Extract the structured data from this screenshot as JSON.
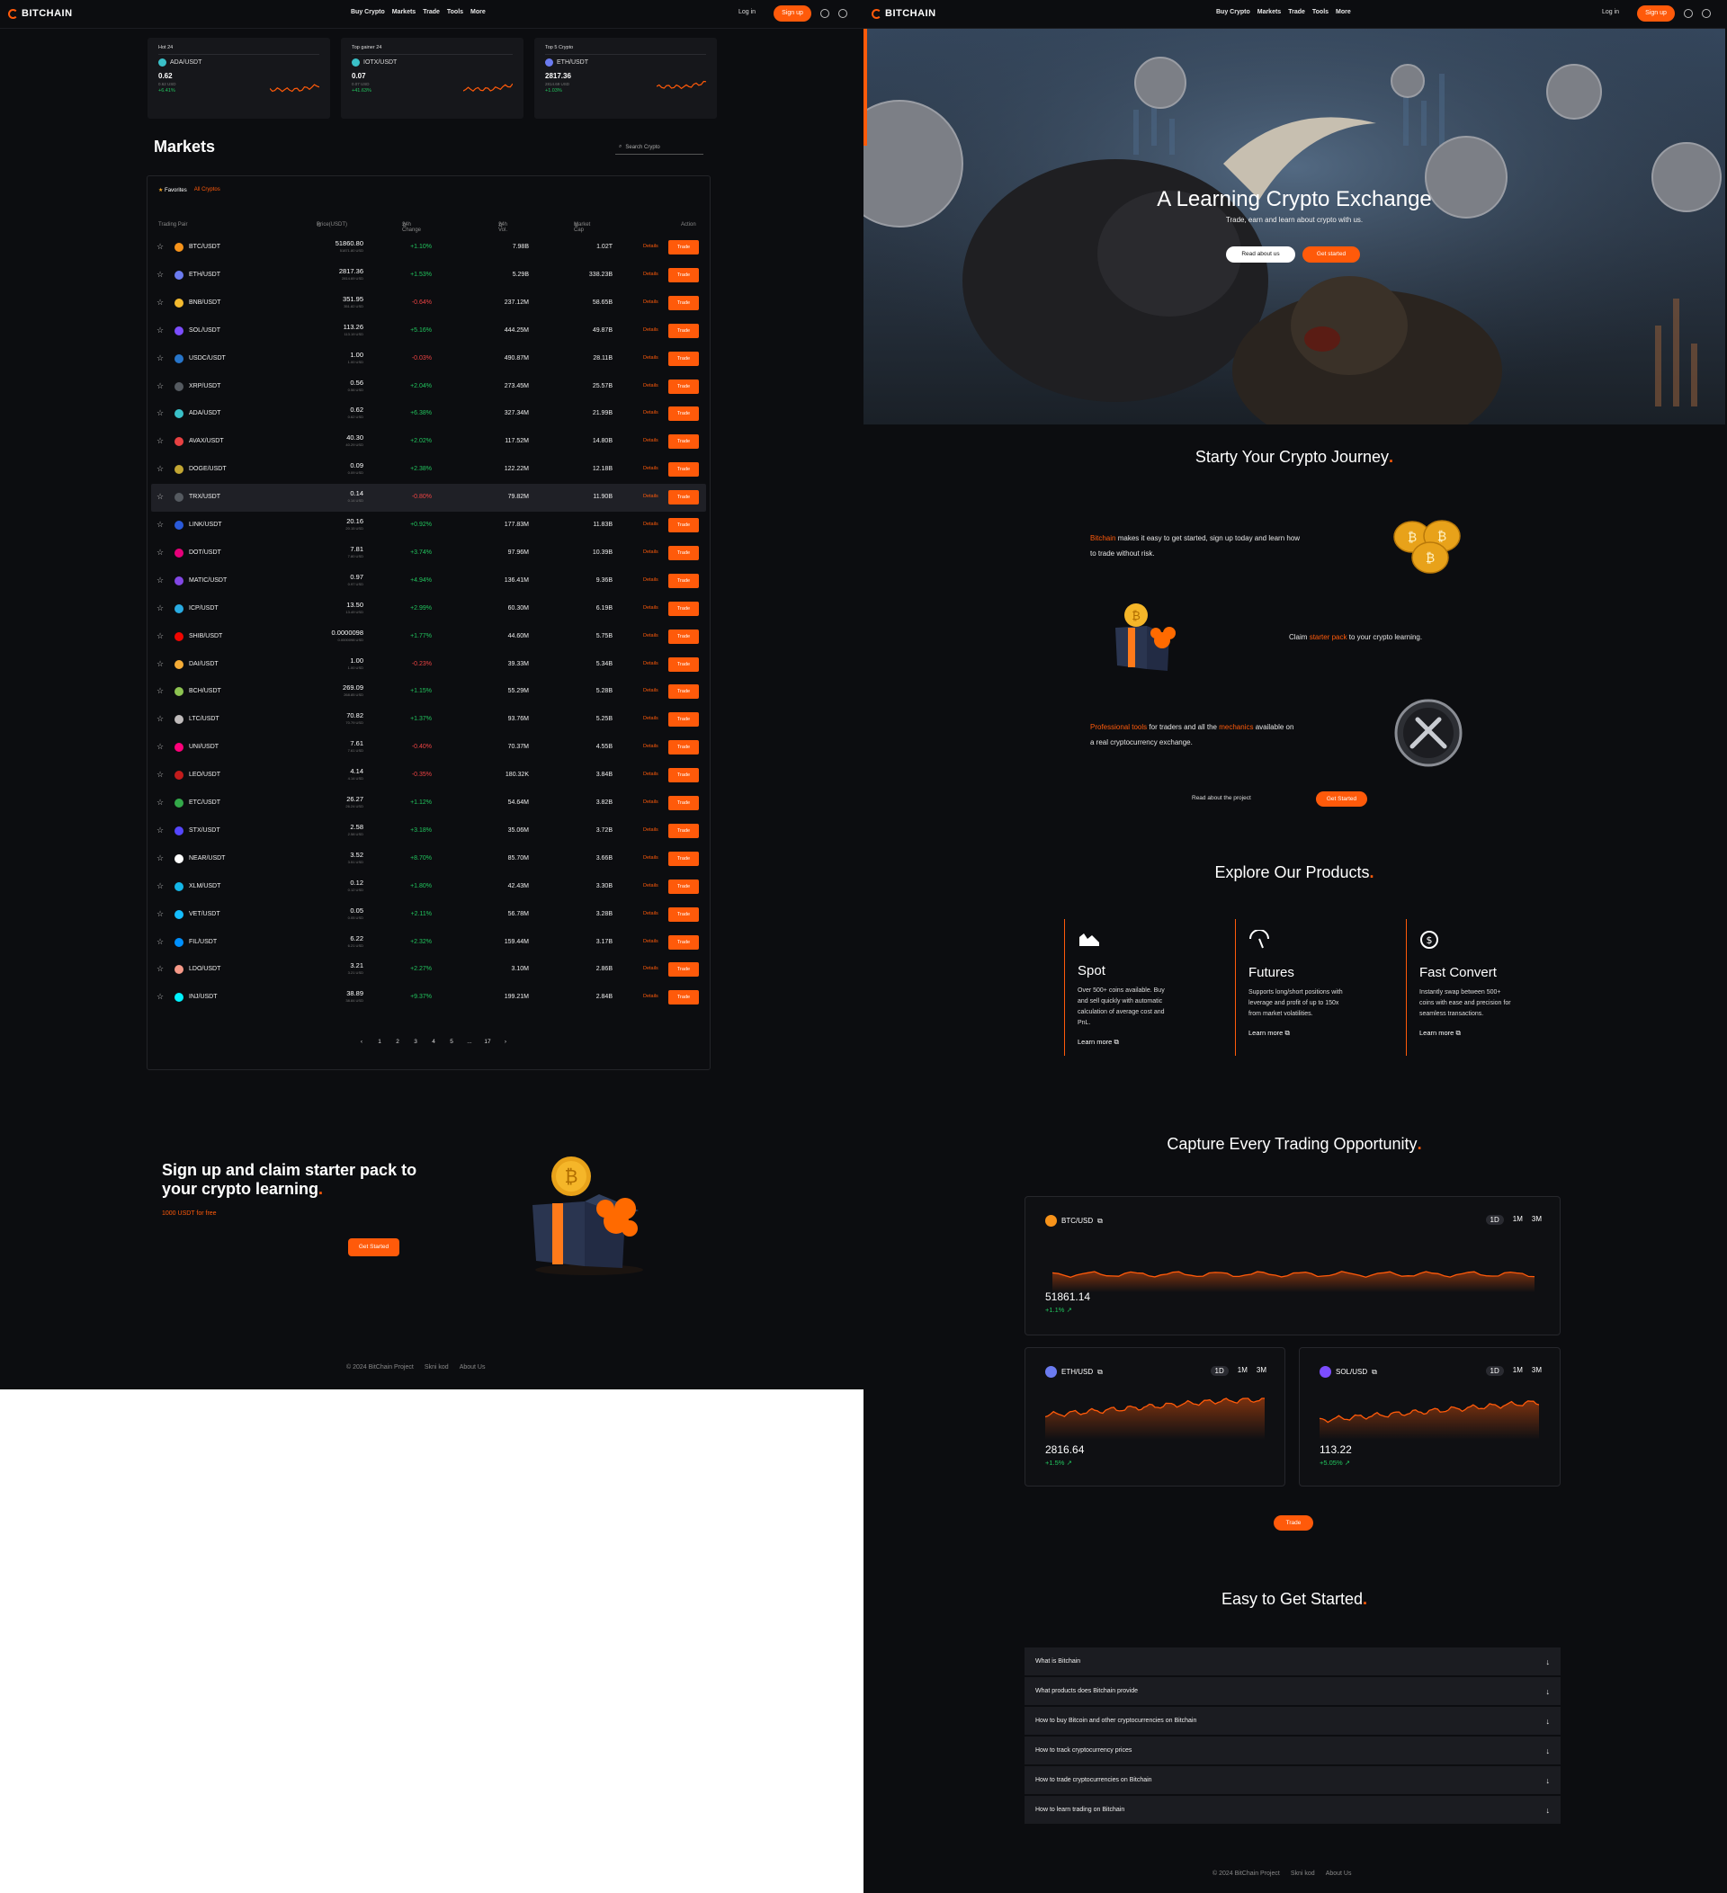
{
  "nav": {
    "brand": "BITCHAIN",
    "menu": [
      "Buy Crypto",
      "Markets",
      "Trade",
      "Tools",
      "More"
    ],
    "login": "Log in",
    "signup": "Sign up"
  },
  "cards": [
    {
      "label": "Hot 24",
      "pair": "ADA/USDT",
      "value": "0.62",
      "sub": "0.62 USD",
      "change": "+6.41%",
      "color": "#3ac0c8"
    },
    {
      "label": "Top gainer 24",
      "pair": "IOTX/USDT",
      "value": "0.07",
      "sub": "0.07 USD",
      "change": "+41.63%",
      "color": "#3ac0c8"
    },
    {
      "label": "Top 5 Crypto",
      "pair": "ETH/USDT",
      "value": "2817.36",
      "sub": "2814.69 USD",
      "change": "+1.03%",
      "color": "#6b7bf0"
    }
  ],
  "markets": {
    "title": "Markets",
    "search_placeholder": "Search Crypto",
    "tab_favorites": "Favorites",
    "tab_all": "All Cryptos",
    "headers": {
      "pair": "Trading Pair",
      "price": "Price(USDT)",
      "change": "24h Change",
      "vol": "24h Vol.",
      "cap": "Market Cap",
      "action": "Action"
    },
    "details_label": "Details",
    "trade_label": "Trade",
    "rows": [
      {
        "pair": "BTC/USDT",
        "price": "51860.80",
        "sub": "51871.80 USD",
        "change": "+1.10%",
        "vol": "7.98B",
        "cap": "1.02T",
        "color": "#f7931a"
      },
      {
        "pair": "ETH/USDT",
        "price": "2817.36",
        "sub": "2814.69 USD",
        "change": "+1.53%",
        "vol": "5.29B",
        "cap": "338.23B",
        "color": "#6b7bf0"
      },
      {
        "pair": "BNB/USDT",
        "price": "351.95",
        "sub": "351.82 USD",
        "change": "-0.64%",
        "vol": "237.12M",
        "cap": "58.65B",
        "color": "#f3ba2f"
      },
      {
        "pair": "SOL/USDT",
        "price": "113.26",
        "sub": "113.19 USD",
        "change": "+5.16%",
        "vol": "444.25M",
        "cap": "49.87B",
        "color": "#7c4dff"
      },
      {
        "pair": "USDC/USDT",
        "price": "1.00",
        "sub": "1.00 USD",
        "change": "-0.03%",
        "vol": "490.87M",
        "cap": "28.11B",
        "color": "#2775ca"
      },
      {
        "pair": "XRP/USDT",
        "price": "0.56",
        "sub": "0.56 USD",
        "change": "+2.04%",
        "vol": "273.45M",
        "cap": "25.57B",
        "color": "#555a60"
      },
      {
        "pair": "ADA/USDT",
        "price": "0.62",
        "sub": "0.62 USD",
        "change": "+6.38%",
        "vol": "327.34M",
        "cap": "21.99B",
        "color": "#3ac0c8"
      },
      {
        "pair": "AVAX/USDT",
        "price": "40.30",
        "sub": "40.29 USD",
        "change": "+2.02%",
        "vol": "117.52M",
        "cap": "14.80B",
        "color": "#e84142"
      },
      {
        "pair": "DOGE/USDT",
        "price": "0.09",
        "sub": "0.09 USD",
        "change": "+2.38%",
        "vol": "122.22M",
        "cap": "12.18B",
        "color": "#c2a633"
      },
      {
        "pair": "TRX/USDT",
        "price": "0.14",
        "sub": "0.14 USD",
        "change": "-0.80%",
        "vol": "79.82M",
        "cap": "11.90B",
        "color": "#555a60"
      },
      {
        "pair": "LINK/USDT",
        "price": "20.16",
        "sub": "20.15 USD",
        "change": "+0.92%",
        "vol": "177.83M",
        "cap": "11.83B",
        "color": "#2a5ada"
      },
      {
        "pair": "DOT/USDT",
        "price": "7.81",
        "sub": "7.80 USD",
        "change": "+3.74%",
        "vol": "97.96M",
        "cap": "10.39B",
        "color": "#e6007a"
      },
      {
        "pair": "MATIC/USDT",
        "price": "0.97",
        "sub": "0.97 USD",
        "change": "+4.94%",
        "vol": "136.41M",
        "cap": "9.36B",
        "color": "#8247e5"
      },
      {
        "pair": "ICP/USDT",
        "price": "13.50",
        "sub": "13.49 USD",
        "change": "+2.99%",
        "vol": "60.30M",
        "cap": "6.19B",
        "color": "#29abe2"
      },
      {
        "pair": "SHIB/USDT",
        "price": "0.0000098",
        "sub": "0.0000098 USD",
        "change": "+1.77%",
        "vol": "44.60M",
        "cap": "5.75B",
        "color": "#f00500"
      },
      {
        "pair": "DAI/USDT",
        "price": "1.00",
        "sub": "1.00 USD",
        "change": "-0.23%",
        "vol": "39.33M",
        "cap": "5.34B",
        "color": "#f5ac37"
      },
      {
        "pair": "BCH/USDT",
        "price": "269.09",
        "sub": "268.85 USD",
        "change": "+1.15%",
        "vol": "55.29M",
        "cap": "5.28B",
        "color": "#8dc351"
      },
      {
        "pair": "LTC/USDT",
        "price": "70.82",
        "sub": "70.79 USD",
        "change": "+1.37%",
        "vol": "93.76M",
        "cap": "5.25B",
        "color": "#bfbbbb"
      },
      {
        "pair": "UNI/USDT",
        "price": "7.61",
        "sub": "7.61 USD",
        "change": "-0.40%",
        "vol": "70.37M",
        "cap": "4.55B",
        "color": "#ff007a"
      },
      {
        "pair": "LEO/USDT",
        "price": "4.14",
        "sub": "4.14 USD",
        "change": "-0.35%",
        "vol": "180.32K",
        "cap": "3.84B",
        "color": "#c21c1c"
      },
      {
        "pair": "ETC/USDT",
        "price": "26.27",
        "sub": "26.24 USD",
        "change": "+1.12%",
        "vol": "54.64M",
        "cap": "3.82B",
        "color": "#33a849"
      },
      {
        "pair": "STX/USDT",
        "price": "2.58",
        "sub": "2.58 USD",
        "change": "+3.18%",
        "vol": "35.06M",
        "cap": "3.72B",
        "color": "#5546ff"
      },
      {
        "pair": "NEAR/USDT",
        "price": "3.52",
        "sub": "3.51 USD",
        "change": "+8.70%",
        "vol": "85.70M",
        "cap": "3.66B",
        "color": "#ffffff"
      },
      {
        "pair": "XLM/USDT",
        "price": "0.12",
        "sub": "0.12 USD",
        "change": "+1.80%",
        "vol": "42.43M",
        "cap": "3.30B",
        "color": "#14b6e7"
      },
      {
        "pair": "VET/USDT",
        "price": "0.05",
        "sub": "0.05 USD",
        "change": "+2.11%",
        "vol": "56.78M",
        "cap": "3.28B",
        "color": "#15bdff"
      },
      {
        "pair": "FIL/USDT",
        "price": "6.22",
        "sub": "6.21 USD",
        "change": "+2.32%",
        "vol": "159.44M",
        "cap": "3.17B",
        "color": "#0090ff"
      },
      {
        "pair": "LDO/USDT",
        "price": "3.21",
        "sub": "3.21 USD",
        "change": "+2.27%",
        "vol": "3.10M",
        "cap": "2.86B",
        "color": "#f69988"
      },
      {
        "pair": "INJ/USDT",
        "price": "38.89",
        "sub": "38.84 USD",
        "change": "+9.37%",
        "vol": "199.21M",
        "cap": "2.84B",
        "color": "#00f2fe"
      }
    ],
    "pagination": [
      "‹",
      "1",
      "2",
      "3",
      "4",
      "5",
      "...",
      "17",
      "›"
    ]
  },
  "promo": {
    "title_a": "Sign up and claim starter pack to your crypto learning",
    "title_dot": ".",
    "subtitle": "1000 USDT for free",
    "cta": "Get Started"
  },
  "footer": {
    "copyright": "2024 BitChain Project",
    "link1": "Skni kod",
    "link2": "About Us"
  },
  "hero": {
    "title": "A Learning Crypto Exchange",
    "subtitle": "Trade, earn and learn about crypto with us.",
    "btn_about": "Read about us",
    "btn_start": "Get started"
  },
  "journey": {
    "title": "Starty Your Crypto Journey",
    "dot": ".",
    "p1_brand": "Bitchain",
    "p1_text": "makes it easy to get started, sign up today and learn how to trade without risk.",
    "p2_a": "Claim",
    "p2_o": "starter pack",
    "p2_b": "to your crypto learning.",
    "p3_o1": "Professional tools",
    "p3_a": "for traders and all the",
    "p3_o2": "mechanics",
    "p3_b": "available on a real cryptocurrency exchange.",
    "read_project": "Read about the project",
    "cta": "Get Started"
  },
  "products": {
    "title": "Explore Our Products",
    "dot": ".",
    "learn_more": "Learn more",
    "items": [
      {
        "name": "Spot",
        "desc": "Over 500+ coins available. Buy and sell quickly with automatic calculation of average cost and PnL.",
        "icon": "chart-area-icon"
      },
      {
        "name": "Futures",
        "desc": "Supports long/short positions with leverage and profit of up to 150x from market volatilities.",
        "icon": "gauge-icon"
      },
      {
        "name": "Fast Convert",
        "desc": "Instantly swap between 500+ coins with ease and precision for seamless transactions.",
        "icon": "convert-icon"
      }
    ]
  },
  "capture": {
    "title": "Capture Every Trading Opportunity",
    "dot": ".",
    "trade": "Trade",
    "charts": [
      {
        "pair": "BTC/USD",
        "value": "51861.14",
        "change": "+1.1%",
        "color": "#f7931a",
        "tf": [
          "1D",
          "1M",
          "3M"
        ]
      },
      {
        "pair": "ETH/USD",
        "value": "2816.64",
        "change": "+1.5%",
        "color": "#6b7bf0",
        "tf": [
          "1D",
          "1M",
          "3M"
        ]
      },
      {
        "pair": "SOL/USD",
        "value": "113.22",
        "change": "+5.05%",
        "color": "#7c4dff",
        "tf": [
          "1D",
          "1M",
          "3M"
        ]
      }
    ]
  },
  "faq": {
    "title": "Easy to Get Started",
    "dot": ".",
    "items": [
      "What is Bitchain",
      "What products does Bitchain provide",
      "How to buy Bitcoin and other cryptocurrencies on Bitchain",
      "How to track cryptocurrency prices",
      "How to trade cryptocurrencies on Bitchain",
      "How to learn trading on Bitchain"
    ]
  }
}
